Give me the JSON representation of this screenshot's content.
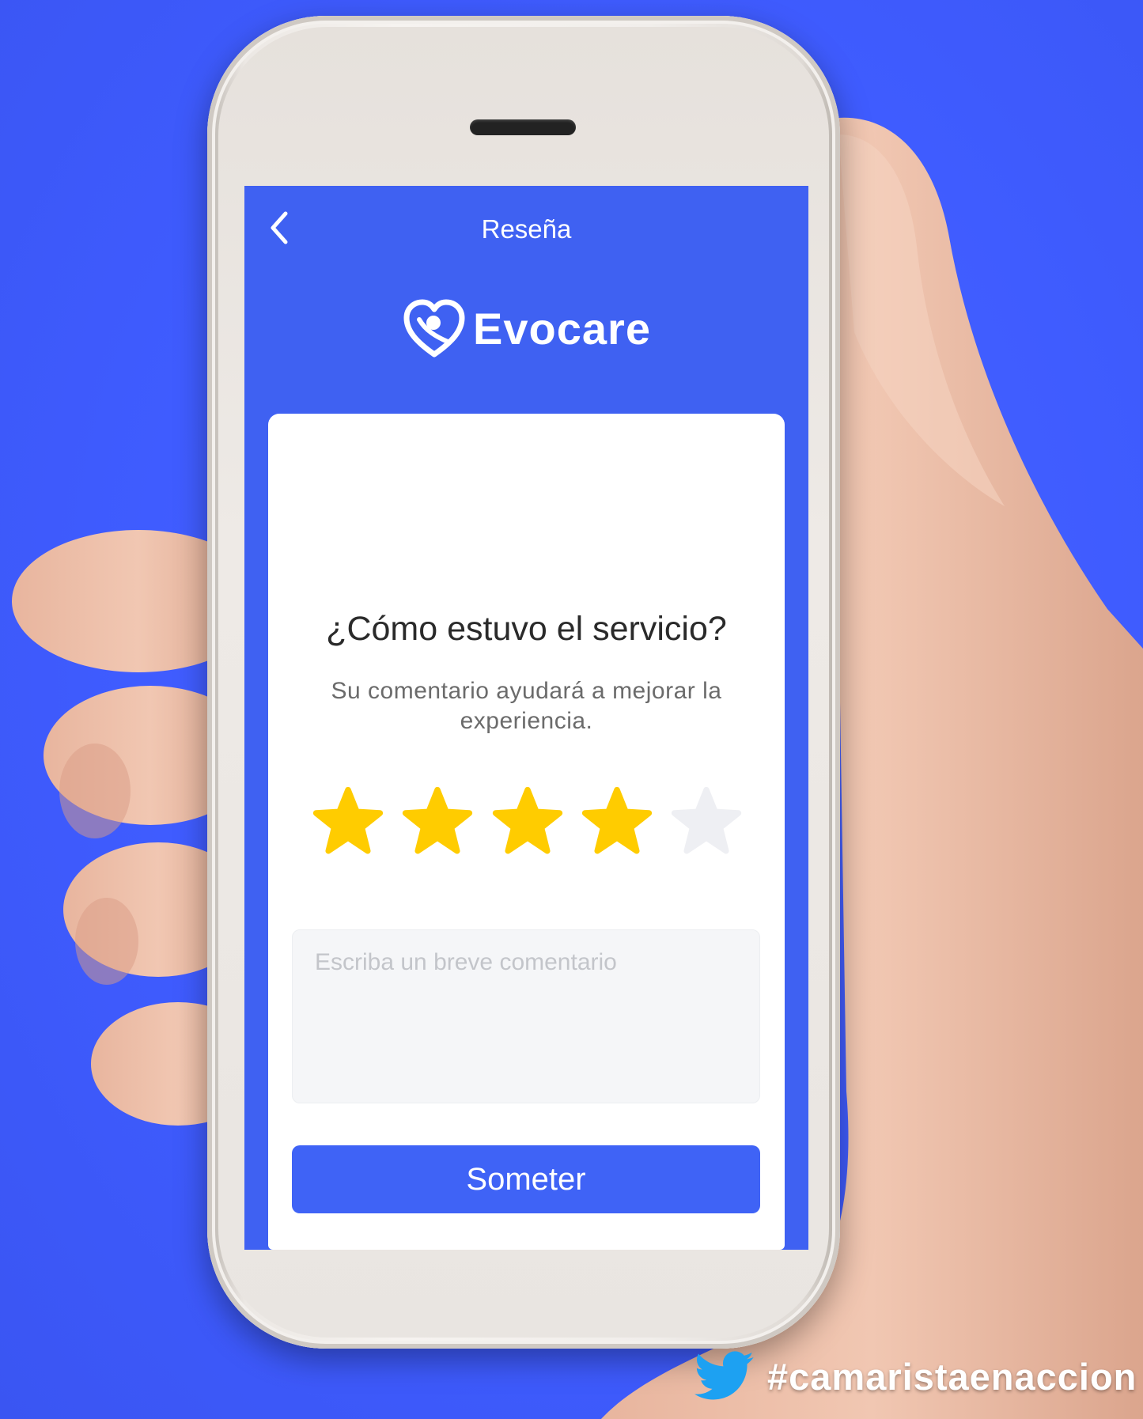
{
  "screen": {
    "nav": {
      "title": "Reseña"
    },
    "logo": {
      "text": "Evocare"
    },
    "card": {
      "question": "¿Cómo estuvo el servicio?",
      "subtitle": "Su comentario ayudará a mejorar la experiencia.",
      "rating": {
        "value": 4,
        "max": 5,
        "filled_color": "#ffcc00",
        "empty_color": "#eeeff3"
      },
      "comment": {
        "placeholder": "Escriba un breve comentario",
        "value": ""
      },
      "submit_label": "Someter"
    }
  },
  "watermark": {
    "hashtag": "#camaristaenaccion"
  },
  "colors": {
    "background": "#4060ff",
    "screen": "#3f61f2",
    "button": "#3f63f6"
  }
}
